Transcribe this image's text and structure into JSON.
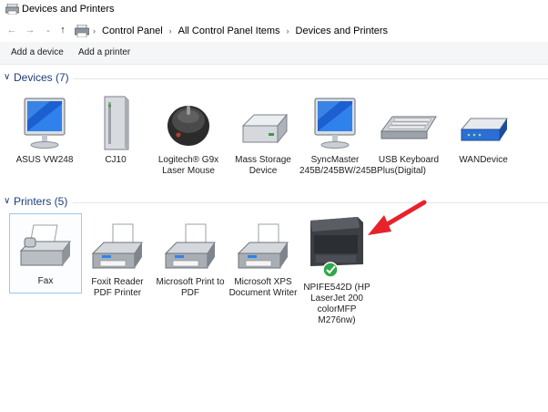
{
  "window": {
    "title": "Devices and Printers"
  },
  "address": {
    "crumbs": [
      "Control Panel",
      "All Control Panel Items",
      "Devices and Printers"
    ]
  },
  "toolbar": {
    "add_device": "Add a device",
    "add_printer": "Add a printer"
  },
  "devices": {
    "header": "Devices (7)",
    "items": [
      {
        "label": "ASUS VW248",
        "icon": "monitor-icon"
      },
      {
        "label": "CJ10",
        "icon": "pc-tower-icon"
      },
      {
        "label": "Logitech® G9x Laser Mouse",
        "icon": "mouse-icon"
      },
      {
        "label": "Mass Storage Device",
        "icon": "drive-icon"
      },
      {
        "label": "SyncMaster 245B/245BW/245BPlus(Digital)",
        "icon": "monitor-icon"
      },
      {
        "label": "USB Keyboard",
        "icon": "keyboard-icon"
      },
      {
        "label": "WANDevice",
        "icon": "router-icon"
      }
    ]
  },
  "printers": {
    "header": "Printers (5)",
    "items": [
      {
        "label": "Fax",
        "icon": "fax-icon",
        "selected": true
      },
      {
        "label": "Foxit Reader PDF Printer",
        "icon": "printer-icon"
      },
      {
        "label": "Microsoft Print to PDF",
        "icon": "printer-icon"
      },
      {
        "label": "Microsoft XPS Document Writer",
        "icon": "printer-icon"
      },
      {
        "label": "NPIFE542D (HP LaserJet 200 colorMFP M276nw)",
        "icon": "mfp-printer-icon",
        "default": true
      }
    ]
  },
  "colors": {
    "group_header": "#1e3c7a",
    "selection_border": "#99c9ef",
    "annotation_arrow": "#e8222b",
    "default_check": "#2ea84a"
  }
}
